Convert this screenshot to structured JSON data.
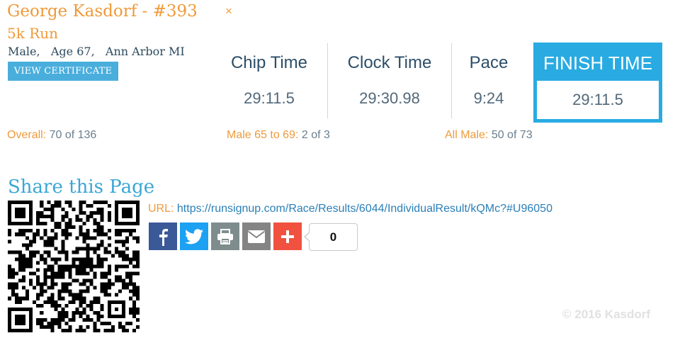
{
  "runner": {
    "name": "George Kasdorf - #393",
    "close_glyph": "×",
    "event": "5k Run",
    "gender": "Male,",
    "age": "Age 67,",
    "location": "Ann Arbor MI",
    "certificate_label": "VIEW CERTIFICATE"
  },
  "results": {
    "chip_label": "Chip Time",
    "chip_value": "29:11.5",
    "clock_label": "Clock Time",
    "clock_value": "29:30.98",
    "pace_label": "Pace",
    "pace_value": "9:24",
    "finish_label": "FINISH TIME",
    "finish_value": "29:11.5"
  },
  "placements": {
    "overall_label": "Overall:",
    "overall_value": "70 of 136",
    "division_label": "Male 65 to 69:",
    "division_value": "2 of 3",
    "gender_label": "All Male:",
    "gender_value": "50 of 73"
  },
  "share": {
    "title": "Share this Page",
    "url_label": "URL:",
    "url": "https://runsignup.com/Race/Results/6044/IndividualResult/kQMc?#U96050",
    "buttons": [
      {
        "icon": "facebook-icon",
        "color": "#3b5998"
      },
      {
        "icon": "twitter-icon",
        "color": "#1da1f2"
      },
      {
        "icon": "print-icon",
        "color": "#7f8c8d"
      },
      {
        "icon": "email-icon",
        "color": "#848484"
      },
      {
        "icon": "add-icon",
        "color": "#f0523f"
      }
    ],
    "share_count": "0"
  },
  "footer": {
    "copyright": "© 2016 Kasdorf"
  },
  "colors": {
    "accent_orange": "#ef9a3a",
    "accent_blue": "#29abe2",
    "text_dark": "#2d4e68"
  }
}
